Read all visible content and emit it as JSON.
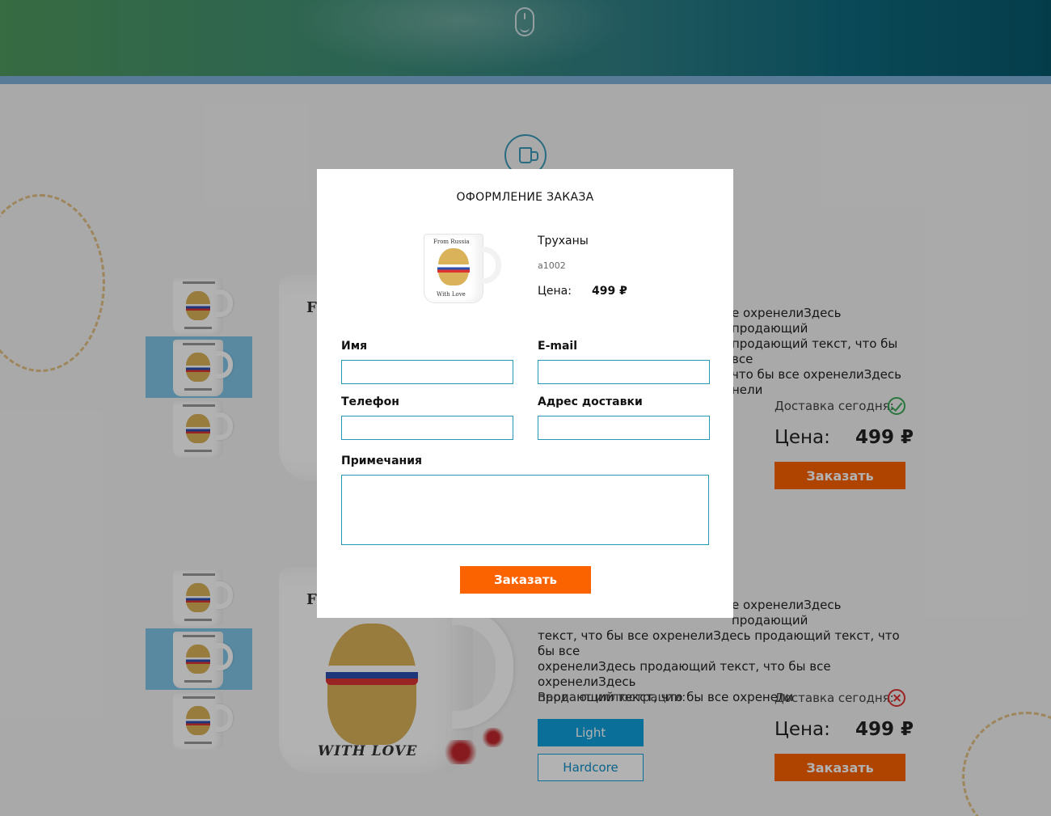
{
  "background": {
    "product_1": {
      "description_line1": "е охренелиЗдесь продающий",
      "description_line2": "продающий текст, что бы все",
      "description_line3": "что бы все охренелиЗдесь",
      "description_line4": "нели",
      "delivery_label": "Доставка сегодня:",
      "delivery_available": true,
      "price_label": "Цена:",
      "price": "499 ₽",
      "order_label": "Заказать"
    },
    "product_2": {
      "description_line1": "е охренелиЗдесь продающий",
      "description_line2": "текст, что бы все охренелиЗдесь продающий текст, что бы все",
      "description_line3": "охренелиЗдесь продающий текст, что бы все охренелиЗдесь",
      "description_line4": "продающий текст, что бы все охренели",
      "variant_label": "Вариант иллюстрации:",
      "variants": [
        "Light",
        "Hardcore"
      ],
      "selected_variant": "Light",
      "delivery_label": "Доставка сегодня:",
      "delivery_available": false,
      "price_label": "Цена:",
      "price": "499 ₽",
      "order_label": "Заказать"
    },
    "mug_print": {
      "top_text": "F",
      "bottom_text": "WITH LOVE",
      "mini_top": "From Russia",
      "mini_bottom": "With Love"
    }
  },
  "modal": {
    "title": "ОФОРМЛЕНИЕ ЗАКАЗА",
    "product_name": "Труханы",
    "sku": "a1002",
    "price_label": "Цена:",
    "price": "499 ₽",
    "fields": {
      "name_label": "Имя",
      "name_value": "",
      "email_label": "E-mail",
      "email_value": "",
      "phone_label": "Телефон",
      "phone_value": "",
      "address_label": "Адрес доставки",
      "address_value": "",
      "notes_label": "Примечания",
      "notes_value": ""
    },
    "submit_label": "Заказать"
  },
  "colors": {
    "accent_orange": "#fb6200",
    "accent_blue": "#0fa0dc",
    "field_border": "#2597b3",
    "delivery_yes": "#3aaa5a",
    "delivery_no": "#dd3333"
  }
}
